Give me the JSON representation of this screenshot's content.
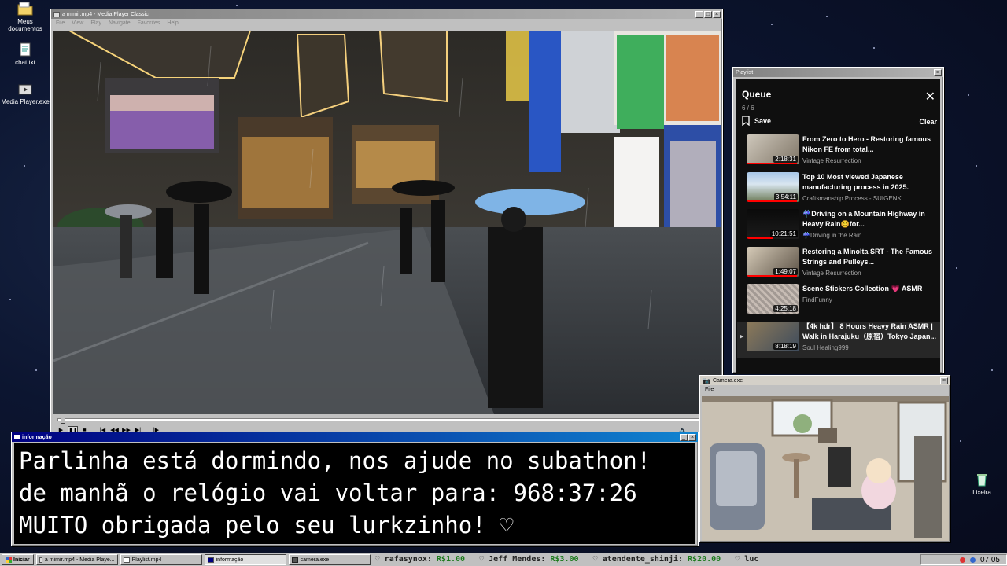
{
  "desktop": {
    "icons": [
      {
        "label": "Meus documentos",
        "icon": "folder-icon"
      },
      {
        "label": "chat.txt",
        "icon": "text-file-icon"
      },
      {
        "label": "Media Player.exe",
        "icon": "media-player-icon"
      },
      {
        "label": "Lixeira",
        "icon": "recycle-bin-icon"
      }
    ]
  },
  "media_player": {
    "title": "a mimir.mp4 - Media Player Classic",
    "menu": [
      "File",
      "View",
      "Play",
      "Navigate",
      "Favorites",
      "Help"
    ],
    "progress": 0.003,
    "controls": [
      "play",
      "pause",
      "stop",
      "prev",
      "rewind",
      "forward",
      "next",
      "frame-step"
    ]
  },
  "playlist": {
    "window_title": "Playlist",
    "header": "Queue",
    "count": "6 / 6",
    "save_label": "Save",
    "clear_label": "Clear",
    "items": [
      {
        "title": "From Zero to Hero - Restoring famous Nikon FE from total...",
        "channel": "Vintage Resurrection",
        "duration": "2:18:31",
        "progress": 0.95
      },
      {
        "title": "Top 10 Most viewed Japanese manufacturing process in 2025.",
        "channel": "Craftsmanship Process - SUIGENK...",
        "duration": "3:54:11",
        "progress": 0.95
      },
      {
        "title": "☔Driving on a Mountain Highway in Heavy Rain😊for...",
        "channel": "☔Driving in the Rain",
        "duration": "10:21:51",
        "progress": 0.5
      },
      {
        "title": "Restoring a Minolta SRT - The Famous Strings and Pulleys...",
        "channel": "Vintage Resurrection",
        "duration": "1:49:07",
        "progress": 0.95
      },
      {
        "title": "Scene Stickers Collection 💗 ASMR",
        "channel": "FindFunny",
        "duration": "4:25:18",
        "progress": 0.0
      },
      {
        "title": "【4k hdr】 8 Hours Heavy Rain ASMR | Walk in Harajuku（原宿）Tokyo Japan...",
        "channel": "Soul Healing999",
        "duration": "8:18:19",
        "progress": 0.0,
        "playing": true
      }
    ]
  },
  "info_window": {
    "title": "informação",
    "lines": [
      "Parlinha está dormindo, nos ajude no subathon!",
      "de manhã o relógio vai voltar para:  968:37:26",
      "MUITO obrigada pelo seu lurkzinho! ♡"
    ]
  },
  "camera_window": {
    "title": "Camera.exe",
    "menu": [
      "File"
    ]
  },
  "taskbar": {
    "start_label": "Iniciar",
    "tasks": [
      {
        "label": "a mimir.mp4 - Media Playe...",
        "active": false
      },
      {
        "label": "Playlist.mp4",
        "active": false
      },
      {
        "label": "informação",
        "active": true
      },
      {
        "label": "camera.exe",
        "active": false
      }
    ],
    "ticker": [
      {
        "name": "rafasynox",
        "amount": "R$1.00"
      },
      {
        "name": "Jeff Mendes",
        "amount": "R$3.00"
      },
      {
        "name": "atendente_shinji",
        "amount": "R$20.00"
      },
      {
        "name": "luc",
        "amount": ""
      }
    ],
    "clock": "07:05"
  }
}
